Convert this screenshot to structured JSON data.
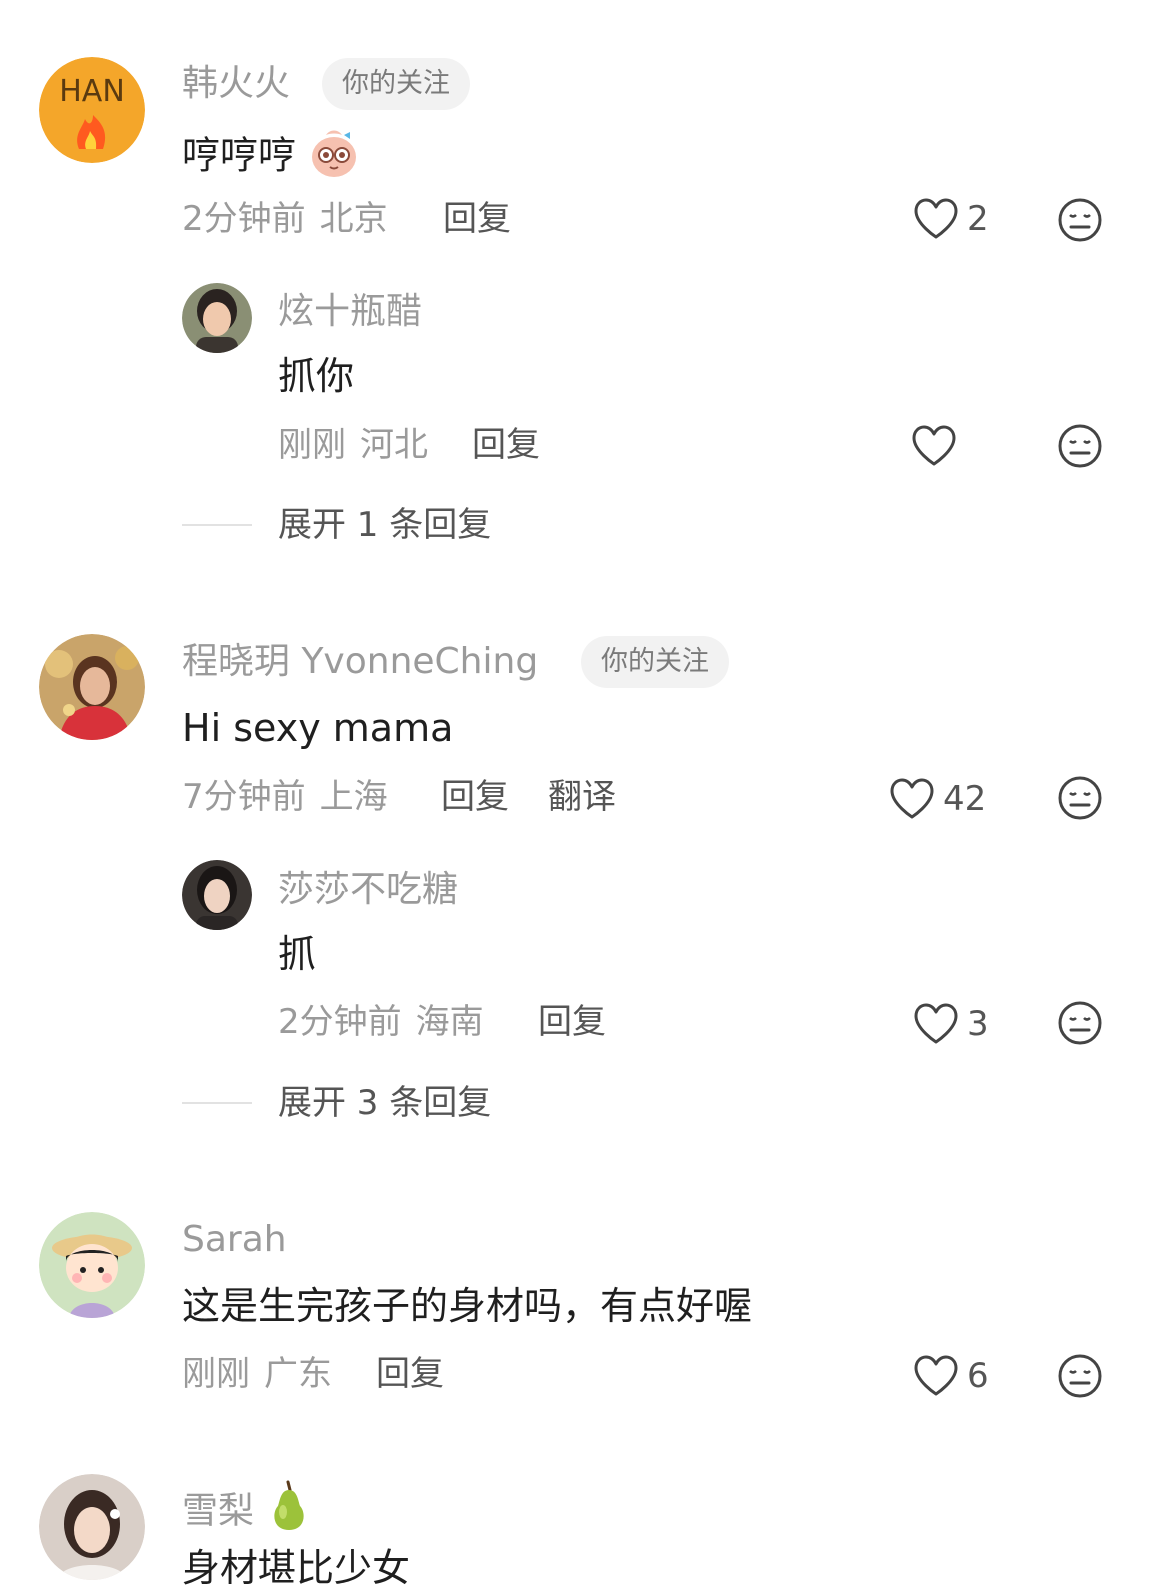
{
  "comments": [
    {
      "author": "韩火火",
      "badge": "你的关注",
      "text": "哼哼哼",
      "time": "2分钟前",
      "location": "北京",
      "reply_label": "回复",
      "likes": "2",
      "avatar_text": "HAN",
      "replies": [
        {
          "author": "炫十瓶醋",
          "text": "抓你",
          "time": "刚刚",
          "location": "河北",
          "reply_label": "回复",
          "likes": ""
        }
      ],
      "expand_label": "展开 1 条回复"
    },
    {
      "author": "程晓玥 YvonneChing",
      "badge": "你的关注",
      "text": "Hi sexy mama",
      "time": "7分钟前",
      "location": "上海",
      "reply_label": "回复",
      "translate_label": "翻译",
      "likes": "42",
      "replies": [
        {
          "author": "莎莎不吃糖",
          "text": "抓",
          "time": "2分钟前",
          "location": "海南",
          "reply_label": "回复",
          "likes": "3"
        }
      ],
      "expand_label": "展开 3 条回复"
    },
    {
      "author": "Sarah",
      "text": "这是生完孩子的身材吗，有点好喔",
      "time": "刚刚",
      "location": "广东",
      "reply_label": "回复",
      "likes": "6"
    },
    {
      "author": "雪梨",
      "text": "身材堪比少女"
    }
  ],
  "colors": {
    "text_primary": "#1f1f1f",
    "text_secondary": "#9a9a9a",
    "action": "#555555",
    "badge_bg": "#f2f2f2"
  }
}
